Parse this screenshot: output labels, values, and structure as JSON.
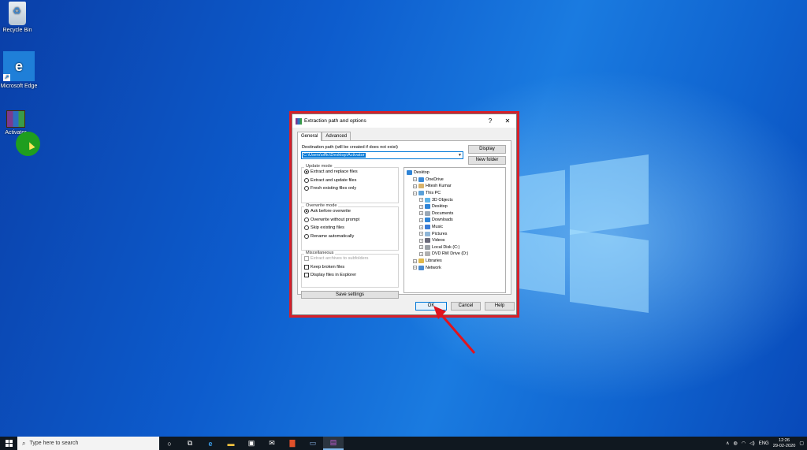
{
  "desktop": {
    "icons": [
      {
        "label": "Recycle Bin"
      },
      {
        "label": "Microsoft Edge"
      },
      {
        "label": "Activator"
      }
    ]
  },
  "dialog": {
    "title": "Extraction path and options",
    "help_glyph": "?",
    "close_glyph": "✕",
    "tabs": [
      "General",
      "Advanced"
    ],
    "dest_label": "Destination path (will be created if does not exist)",
    "dest_value": "C:\\Users\\offic\\Desktop\\Activator",
    "display_button": "Display",
    "new_folder_button": "New folder",
    "update_mode": {
      "title": "Update mode",
      "options": [
        "Extract and replace files",
        "Extract and update files",
        "Fresh existing files only"
      ],
      "selected": 0
    },
    "overwrite_mode": {
      "title": "Overwrite mode",
      "options": [
        "Ask before overwrite",
        "Overwrite without prompt",
        "Skip existing files",
        "Rename automatically"
      ],
      "selected": 0
    },
    "misc": {
      "title": "Miscellaneous",
      "options": [
        "Extract archives to subfolders",
        "Keep broken files",
        "Display files in Explorer"
      ]
    },
    "save_button": "Save settings",
    "tree": [
      {
        "label": "Desktop",
        "level": 0,
        "expander": "",
        "color": "#2f84d6"
      },
      {
        "label": "OneDrive",
        "level": 1,
        "expander": "+",
        "color": "#3a8ad8"
      },
      {
        "label": "Hitesh Kumar",
        "level": 1,
        "expander": "+",
        "color": "#d9b36a"
      },
      {
        "label": "This PC",
        "level": 1,
        "expander": "−",
        "color": "#5aa0d8"
      },
      {
        "label": "3D Objects",
        "level": 2,
        "expander": "+",
        "color": "#5fb4e8"
      },
      {
        "label": "Desktop",
        "level": 2,
        "expander": "+",
        "color": "#2f84d6"
      },
      {
        "label": "Documents",
        "level": 2,
        "expander": "+",
        "color": "#9aa8b6"
      },
      {
        "label": "Downloads",
        "level": 2,
        "expander": "+",
        "color": "#2f84d6"
      },
      {
        "label": "Music",
        "level": 2,
        "expander": "+",
        "color": "#3a7bd5"
      },
      {
        "label": "Pictures",
        "level": 2,
        "expander": "+",
        "color": "#8fb6d8"
      },
      {
        "label": "Videos",
        "level": 2,
        "expander": "+",
        "color": "#6a6a7a"
      },
      {
        "label": "Local Disk (C:)",
        "level": 2,
        "expander": "+",
        "color": "#9aa0a6"
      },
      {
        "label": "DVD RW Drive (D:)",
        "level": 2,
        "expander": "+",
        "color": "#b0b0b0"
      },
      {
        "label": "Libraries",
        "level": 1,
        "expander": "+",
        "color": "#e0b84a"
      },
      {
        "label": "Network",
        "level": 1,
        "expander": "+",
        "color": "#4a8ad0"
      }
    ],
    "ok_button": "OK",
    "cancel_button": "Cancel",
    "help_button": "Help"
  },
  "taskbar": {
    "search_placeholder": "Type here to search",
    "language": "ENG",
    "time": "12:26",
    "date": "29-02-2020"
  },
  "colors": {
    "highlight_frame": "#d6202a",
    "accent": "#0078d7"
  }
}
